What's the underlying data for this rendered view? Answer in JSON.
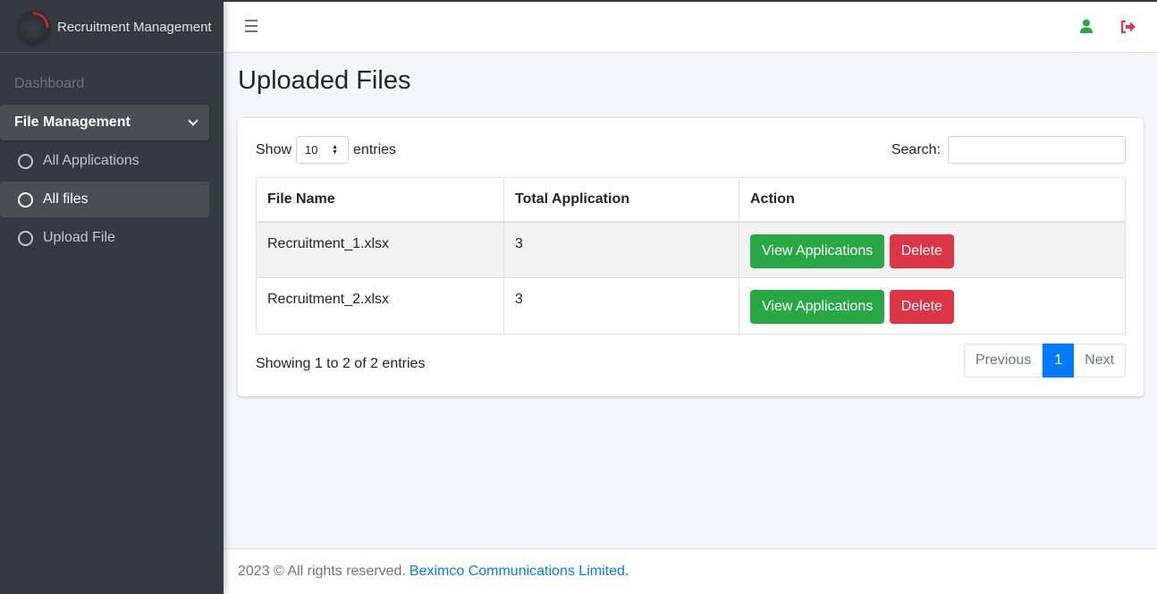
{
  "app": {
    "brand": "Recruitment Management"
  },
  "sidebar": {
    "dashboard": "Dashboard",
    "group": "File Management",
    "items": [
      {
        "label": "All Applications"
      },
      {
        "label": "All files"
      },
      {
        "label": "Upload File"
      }
    ]
  },
  "topbar": {
    "icons": [
      "menu-icon",
      "user-icon",
      "logout-icon"
    ]
  },
  "page": {
    "title": "Uploaded Files"
  },
  "table_controls": {
    "show_label": "Show",
    "entries_value": "10",
    "entries_label": "entries",
    "search_label": "Search:",
    "search_value": ""
  },
  "table": {
    "headers": [
      "File Name",
      "Total Application",
      "Action"
    ],
    "rows": [
      {
        "file": "Recruitment_1.xlsx",
        "total": "3"
      },
      {
        "file": "Recruitment_2.xlsx",
        "total": "3"
      }
    ],
    "view_label": "View Applications",
    "delete_label": "Delete"
  },
  "pagination": {
    "info": "Showing 1 to 2 of 2 entries",
    "previous": "Previous",
    "current": "1",
    "next": "Next"
  },
  "footer": {
    "text": "2023 © All rights reserved.",
    "link": "Beximco Communications Limited."
  },
  "colors": {
    "sidebar_bg": "#343a40",
    "primary": "#007bff",
    "success": "#28a745",
    "danger": "#dc3545",
    "user_icon": "#28a745",
    "logout_icon": "#dc3545"
  }
}
